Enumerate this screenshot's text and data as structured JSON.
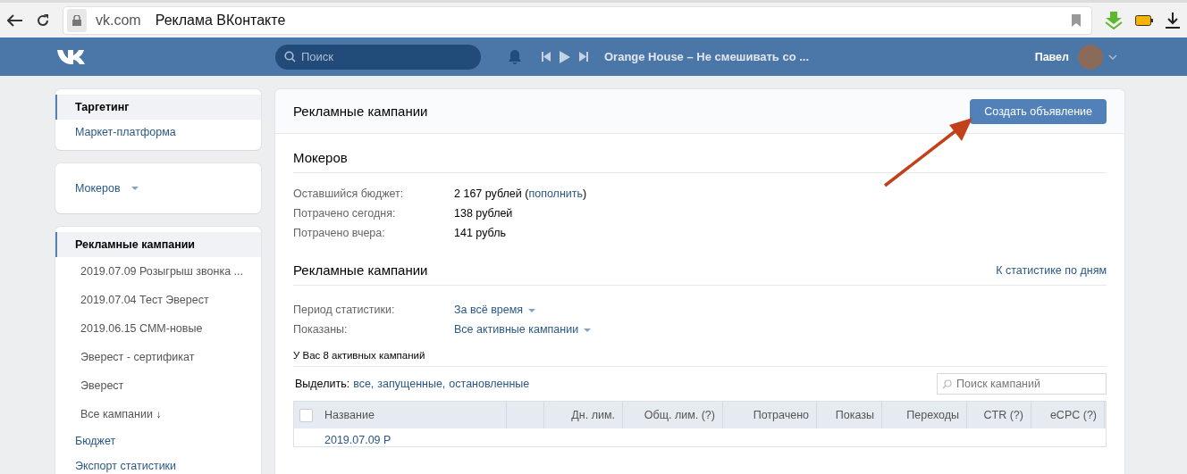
{
  "browser": {
    "domain": "vk.com",
    "page_title": "Реклама ВКонтакте"
  },
  "header": {
    "search_placeholder": "Поиск",
    "track": "Orange House – Не смешивать со ...",
    "user_name": "Павел"
  },
  "sidebar": {
    "groups": [
      {
        "items": [
          {
            "label": "Таргетинг",
            "selected": true
          },
          {
            "label": "Маркет-платформа",
            "selected": false
          }
        ]
      },
      {
        "items": [
          {
            "label": "Мокеров",
            "selected": false,
            "kind": "dropdown"
          }
        ]
      },
      {
        "items": [
          {
            "label": "Рекламные кампании",
            "selected": true,
            "children": [
              {
                "label": "2019.07.09 Розыгрыш звонка ..."
              },
              {
                "label": "2019.07.04 Тест Эверест"
              },
              {
                "label": "2019.06.15 СММ-новые"
              },
              {
                "label": "Эверест - сертификат"
              },
              {
                "label": "Эверест"
              },
              {
                "label": "Все кампании ↓"
              }
            ]
          },
          {
            "label": "Бюджет",
            "selected": false
          },
          {
            "label": "Экспорт статистики",
            "selected": false
          }
        ]
      }
    ]
  },
  "main": {
    "title": "Рекламные кампании",
    "create_button": "Создать объявление",
    "account": {
      "name": "Мокеров",
      "stats": [
        {
          "label": "Оставшийся бюджет:",
          "value": "2 167 рублей (",
          "link": "пополнить",
          "after": ")"
        },
        {
          "label": "Потрачено сегодня:",
          "value": "138 рублей"
        },
        {
          "label": "Потрачено вчера:",
          "value": "141 рубль"
        }
      ]
    },
    "campaigns": {
      "title": "Рекламные кампании",
      "stats_link": "К статистике по дням",
      "filters": [
        {
          "label": "Период статистики:",
          "value": "За всё время"
        },
        {
          "label": "Показаны:",
          "value": "Все активные кампании"
        }
      ],
      "count_text": "У Вас 8 активных кампаний",
      "select_label": "Выделить:",
      "select_options": [
        "все,",
        "запущенные,",
        "остановленные"
      ],
      "search_placeholder": "Поиск кампаний",
      "table": {
        "select_all_checked": false,
        "columns": [
          {
            "label": "Название"
          },
          {},
          {
            "label": "Дн. лим."
          },
          {
            "label": "Общ. лим. (?)"
          },
          {
            "label": "Потрачено"
          },
          {
            "label": "Показы"
          },
          {
            "label": "Переходы"
          },
          {
            "label": "CTR (?)"
          },
          {
            "label": "eCPC (?)"
          }
        ],
        "rows": [
          {
            "name": "2019.07.09 Р"
          }
        ]
      }
    }
  }
}
